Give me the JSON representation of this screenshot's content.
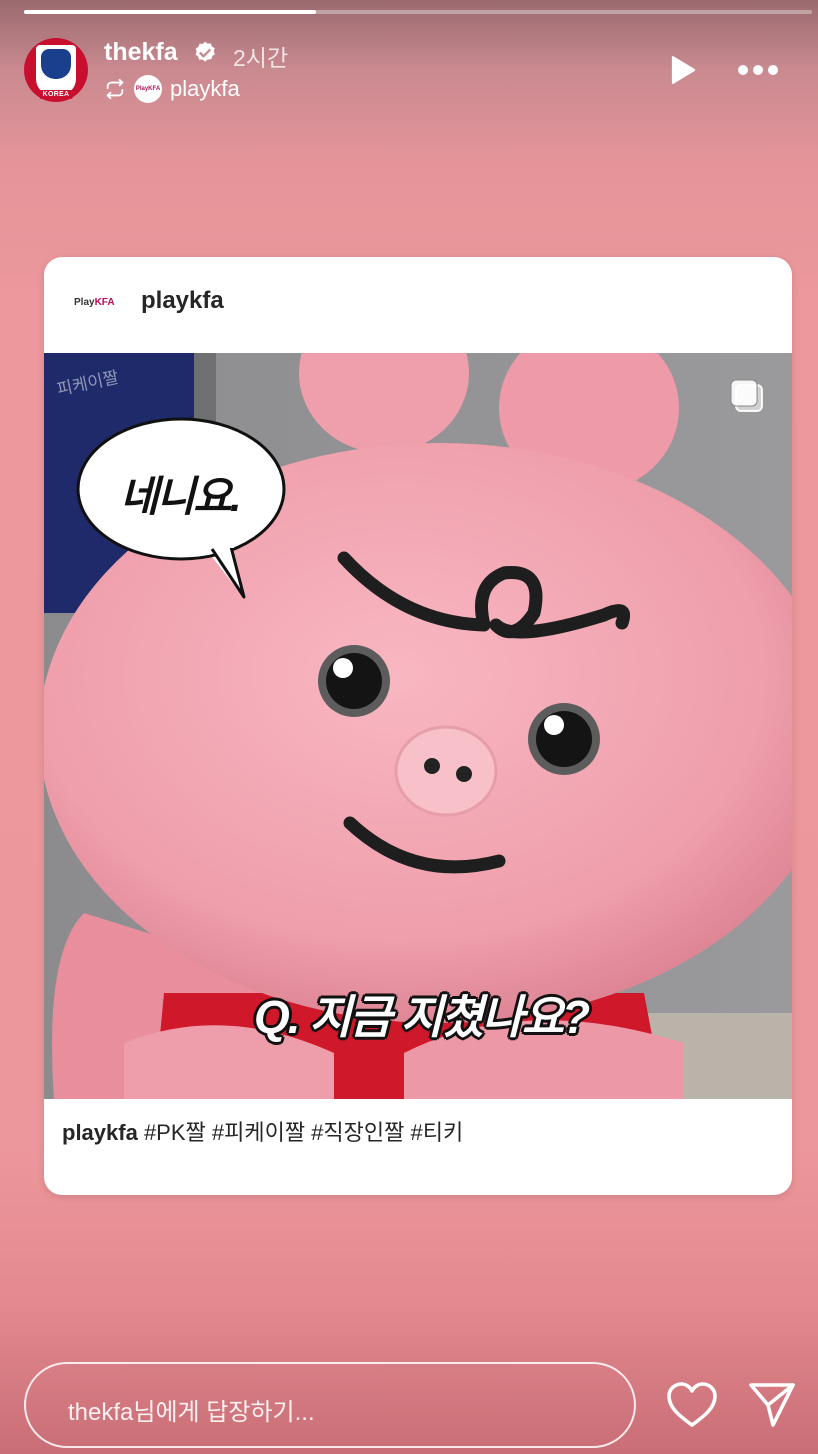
{
  "story": {
    "progress": 0.37,
    "username": "thekfa",
    "time": "2시간",
    "reposted_from": "playkfa",
    "avatar_badge": "KOREA",
    "mini_avatar_logo": "PlayKFA"
  },
  "post": {
    "brand_logo_main": "Play",
    "brand_logo_suffix": "KFA",
    "author": "playkfa",
    "speech_bubble": "네니요.",
    "wall_text": "피케이짤",
    "subtitle": "Q. 지금 지쳤나요?",
    "caption_user": "playkfa",
    "caption_tags": " #PK짤 #피케이짤 #직장인짤 #티키"
  },
  "reply": {
    "placeholder": "thekfa님에게 답장하기..."
  },
  "icons": {
    "verified": "verified-badge-icon",
    "repost": "repost-icon",
    "play": "play-icon",
    "more": "more-icon",
    "multi": "carousel-icon",
    "heart": "heart-icon",
    "send": "send-icon"
  },
  "colors": {
    "background": "#ec989c",
    "kfa_red": "#c8102e",
    "mascot_pink": "#f2a3b0"
  }
}
